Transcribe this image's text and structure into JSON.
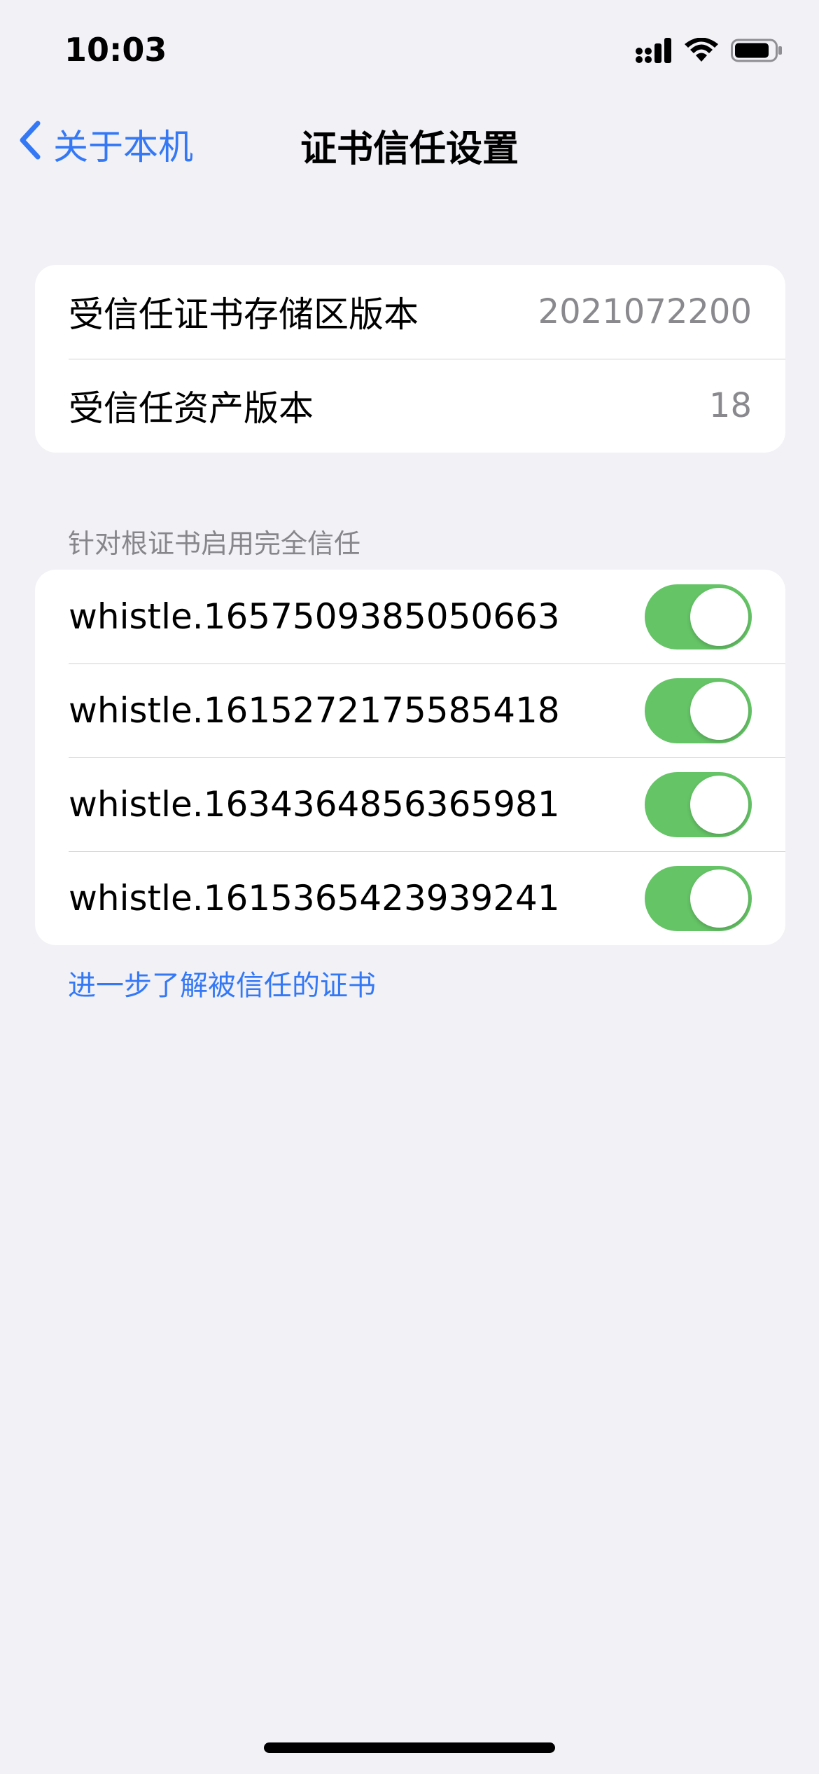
{
  "status_bar": {
    "time": "10:03",
    "icons": [
      "cellular-signal-icon",
      "wifi-icon",
      "battery-icon"
    ]
  },
  "nav": {
    "back_label": "关于本机",
    "title": "证书信任设置"
  },
  "info": {
    "rows": [
      {
        "label": "受信任证书存储区版本",
        "value": "2021072200"
      },
      {
        "label": "受信任资产版本",
        "value": "18"
      }
    ]
  },
  "trust": {
    "header": "针对根证书启用完全信任",
    "certificates": [
      {
        "name": "whistle.1657509385050663",
        "enabled": true
      },
      {
        "name": "whistle.1615272175585418",
        "enabled": true
      },
      {
        "name": "whistle.1634364856365981",
        "enabled": true
      },
      {
        "name": "whistle.1615365423939241",
        "enabled": true
      }
    ]
  },
  "footer": {
    "link": "进一步了解被信任的证书"
  },
  "colors": {
    "background": "#F1F1F6",
    "accent": "#3478F6",
    "toggle_on": "#65C466",
    "secondary_text": "#8A8A8E"
  }
}
